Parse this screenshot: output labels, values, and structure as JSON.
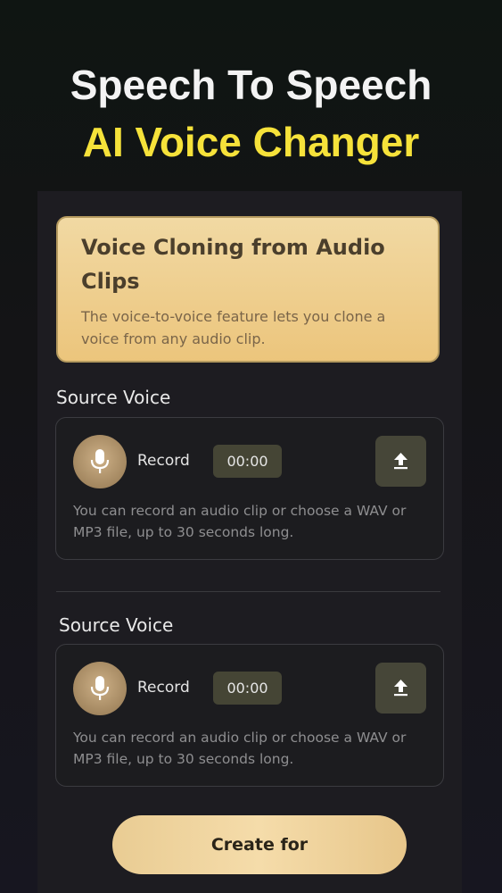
{
  "header": {
    "line1": "Speech To Speech",
    "line2": "AI Voice Changer"
  },
  "feature": {
    "title": "Voice Cloning from Audio Clips",
    "description": "The voice-to-voice feature lets you clone a voice from any audio clip."
  },
  "sources": [
    {
      "label": "Source Voice",
      "record_label": "Record",
      "timer": "00:00",
      "hint": "You can record an audio clip or choose a WAV or MP3 file, up to 30 seconds long.",
      "mic_icon": "microphone-icon",
      "upload_icon": "upload-icon"
    },
    {
      "label": "Source Voice",
      "record_label": "Record",
      "timer": "00:00",
      "hint": "You can record an audio clip or choose a WAV or MP3 file, up to 30 seconds long.",
      "mic_icon": "microphone-icon",
      "upload_icon": "upload-icon"
    }
  ],
  "actions": {
    "create_label": "Create for"
  },
  "colors": {
    "headline_white": "#f3f3f3",
    "headline_yellow": "#f6e23a",
    "gold_accent": "#ecc57c"
  }
}
